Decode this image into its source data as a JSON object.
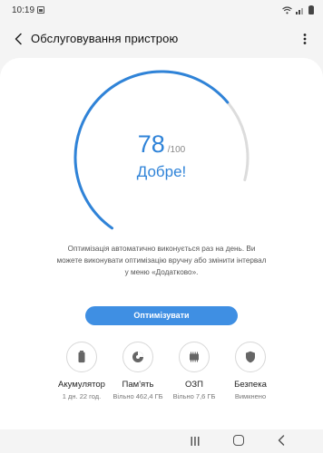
{
  "status_bar": {
    "time": "10:19",
    "icons": [
      "image-icon",
      "wifi-icon",
      "signal-icon",
      "battery-icon"
    ]
  },
  "app_bar": {
    "title": "Обслуговування пристрою",
    "back_icon": "back-arrow-icon",
    "menu_icon": "more-vertical-icon"
  },
  "score": {
    "value": "78",
    "max_label": "/100",
    "fraction": 0.78,
    "status": "Добре!",
    "accent_color": "#2f83d8",
    "track_color": "#dcdcdc"
  },
  "description": "Оптимізація автоматично виконується раз на день. Ви можете виконувати оптимізацію вручну або змінити інтервал у меню «Додатково».",
  "optimize_button": {
    "label": "Оптимізувати",
    "color": "#3f8fe3"
  },
  "categories": [
    {
      "icon": "battery-icon",
      "label": "Акумулятор",
      "value": "1 дн. 22 год."
    },
    {
      "icon": "storage-icon",
      "label": "Пам'ять",
      "value": "Вільно 462,4 ГБ"
    },
    {
      "icon": "ram-chip-icon",
      "label": "ОЗП",
      "value": "Вільно 7,6 ГБ"
    },
    {
      "icon": "shield-icon",
      "label": "Безпека",
      "value": "Вимкнено"
    }
  ],
  "nav_bar": {
    "icons": [
      "recents-icon",
      "home-icon",
      "back-icon"
    ]
  }
}
